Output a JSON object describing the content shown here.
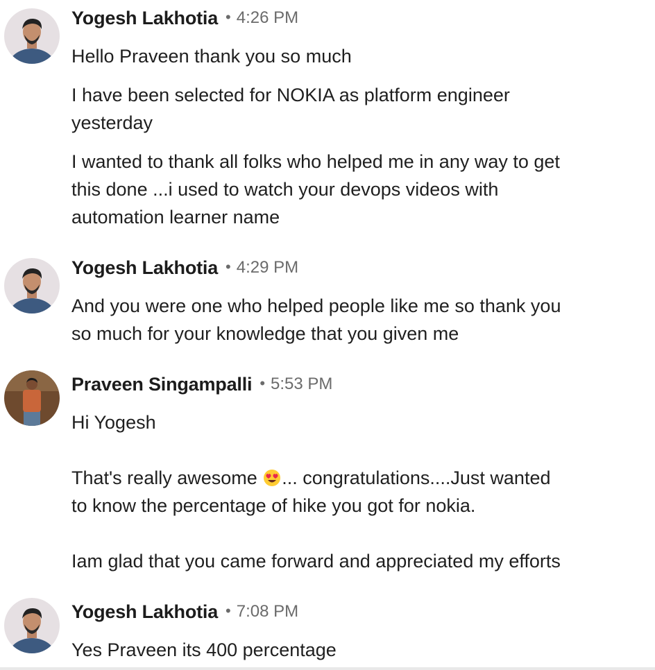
{
  "conversation": {
    "groups": [
      {
        "sender": "Yogesh Lakhotia",
        "time": "4:26 PM",
        "messages": [
          [
            "Hello Praveen thank you so much"
          ],
          [
            "I have been selected for NOKIA as platform engineer",
            "yesterday"
          ],
          [
            "I wanted to thank all folks who helped me in any way to get",
            "this done ...i used to watch your devops videos with",
            "automation learner name"
          ]
        ]
      },
      {
        "sender": "Yogesh Lakhotia",
        "time": "4:29 PM",
        "messages": [
          [
            "And you were one who helped people like me so thank you",
            "so much for your knowledge that you given me"
          ]
        ]
      },
      {
        "sender": "Praveen Singampalli",
        "time": "5:53 PM",
        "messages": [
          [
            "Hi Yogesh"
          ],
          [
            "That's really awesome ",
            "... congratulations....Just wanted",
            "to know the percentage of hike you got for nokia."
          ],
          [
            "Iam glad that you came forward and appreciated my efforts"
          ]
        ]
      },
      {
        "sender": "Yogesh Lakhotia",
        "time": "7:08 PM",
        "messages": [
          [
            "Yes Praveen its 400 percentage"
          ]
        ]
      }
    ],
    "separator": "•",
    "emoji": "heart-eyes-emoji"
  },
  "colors": {
    "text": "#1f1f1f",
    "muted": "#6b6b6b",
    "background": "#ffffff"
  }
}
